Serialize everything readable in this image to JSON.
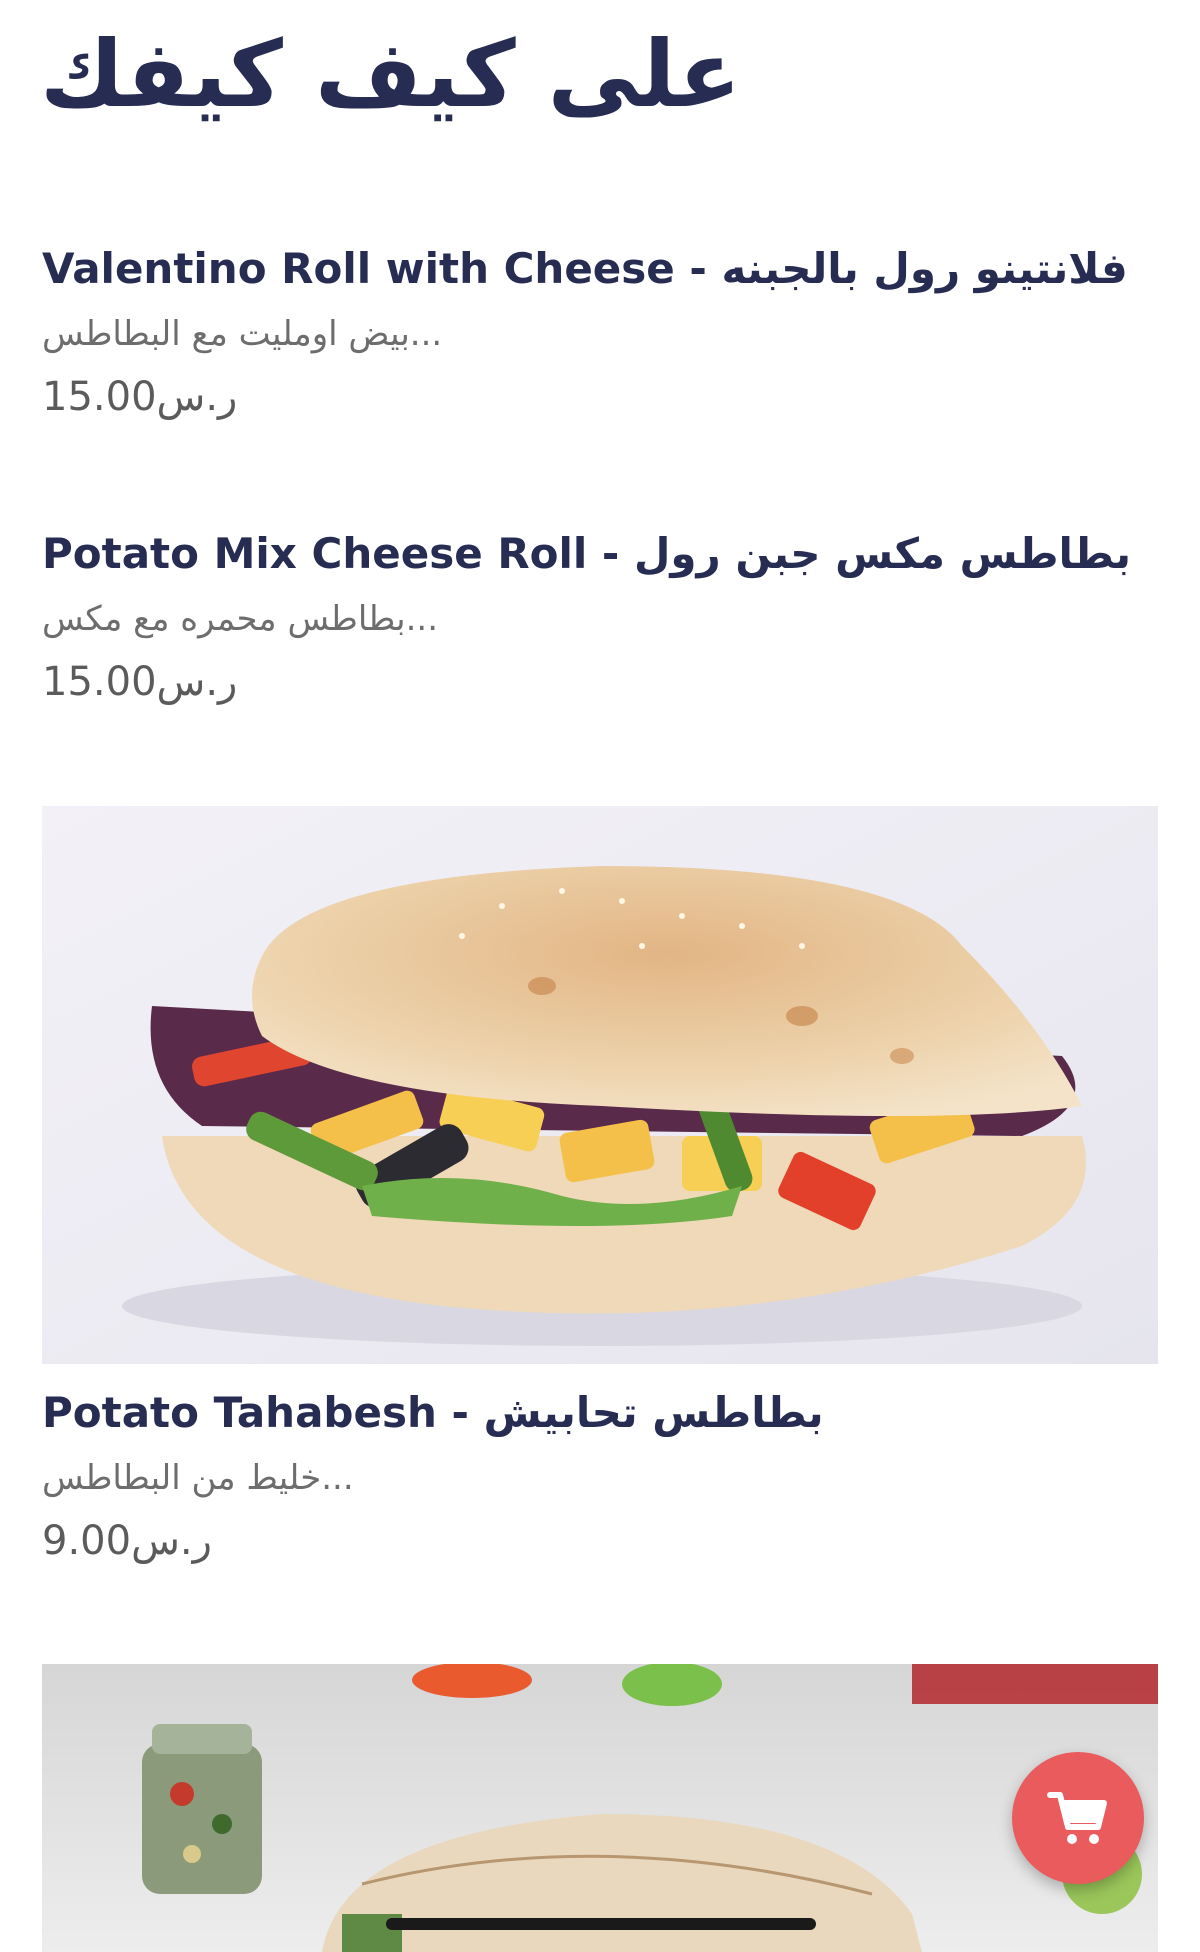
{
  "header": {
    "brand_title": "على كيف كيفك"
  },
  "menu": {
    "items": [
      {
        "name": "Valentino Roll with Cheese - فلانتينو رول بالجبنه",
        "description": "...بيض اومليت مع البطاطس",
        "price": "15.00ر.س"
      },
      {
        "name": "Potato Mix Cheese Roll - بطاطس مكس جبن رول",
        "description": "...بطاطس محمره مع مكس",
        "price": "15.00ر.س"
      },
      {
        "name": "Potato Tahabesh - بطاطس تحابيش",
        "description": "...خليط من البطاطس",
        "price": "9.00ر.س"
      }
    ]
  },
  "cart": {
    "icon": "shopping-cart-icon",
    "color": "#e95b5c"
  },
  "colors": {
    "title": "#272c52",
    "description": "#6d6d6d",
    "price": "#5b5b5b"
  }
}
